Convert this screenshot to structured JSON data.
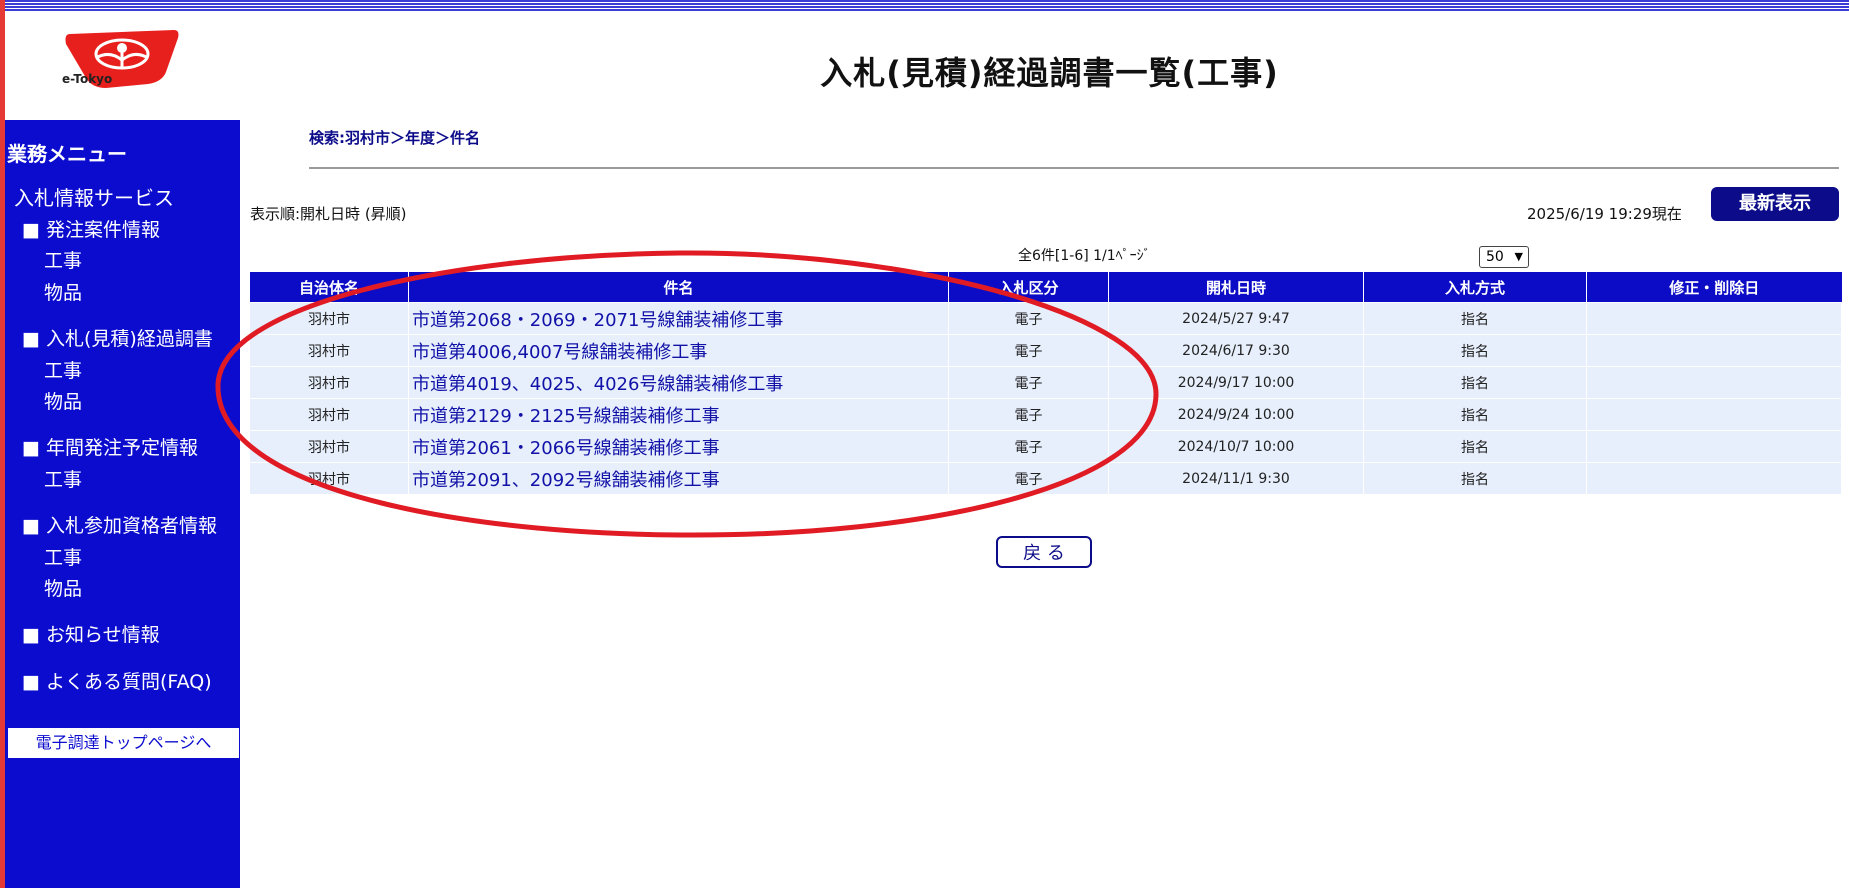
{
  "logo": {
    "text": "e-Tokyo"
  },
  "page_title": "入札(見積)経過調書一覧(工事)",
  "sidebar": {
    "title": "業務メニュー",
    "service": "入札情報サービス",
    "sections": [
      {
        "label": "■ 発注案件情報",
        "items": [
          "工事",
          "物品"
        ]
      },
      {
        "label": "■ 入札(見積)経過調書",
        "items": [
          "工事",
          "物品"
        ]
      },
      {
        "label": "■ 年間発注予定情報",
        "items": [
          "工事"
        ]
      },
      {
        "label": "■ 入札参加資格者情報",
        "items": [
          "工事",
          "物品"
        ]
      },
      {
        "label": "■ お知らせ情報",
        "items": []
      },
      {
        "label": "■ よくある質問(FAQ)",
        "items": []
      }
    ],
    "top_link": "電子調達トップページへ"
  },
  "breadcrumb": "検索:羽村市＞年度＞件名",
  "sort_label": "表示順:開札日時 (昇順)",
  "timestamp": "2025/6/19 19:29現在",
  "refresh_button": "最新表示",
  "count_text": "全6件[1-6] 1/1ﾍﾟｰｼﾞ",
  "per_page": "50",
  "table": {
    "headers": [
      "自治体名",
      "件名",
      "入札区分",
      "開札日時",
      "入札方式",
      "修正・削除日"
    ],
    "rows": [
      {
        "city": "羽村市",
        "name": "市道第2068・2069・2071号線舗装補修工事",
        "type": "電子",
        "date": "2024/5/27 9:47",
        "method": "指名",
        "modified": ""
      },
      {
        "city": "羽村市",
        "name": "市道第4006,4007号線舗装補修工事",
        "type": "電子",
        "date": "2024/6/17 9:30",
        "method": "指名",
        "modified": ""
      },
      {
        "city": "羽村市",
        "name": "市道第4019、4025、4026号線舗装補修工事",
        "type": "電子",
        "date": "2024/9/17 10:00",
        "method": "指名",
        "modified": ""
      },
      {
        "city": "羽村市",
        "name": "市道第2129・2125号線舗装補修工事",
        "type": "電子",
        "date": "2024/9/24 10:00",
        "method": "指名",
        "modified": ""
      },
      {
        "city": "羽村市",
        "name": "市道第2061・2066号線舗装補修工事",
        "type": "電子",
        "date": "2024/10/7 10:00",
        "method": "指名",
        "modified": ""
      },
      {
        "city": "羽村市",
        "name": "市道第2091、2092号線舗装補修工事",
        "type": "電子",
        "date": "2024/11/1 9:30",
        "method": "指名",
        "modified": ""
      }
    ]
  },
  "back_button": "戻 る",
  "colors": {
    "nav_blue": "#0c0ccf",
    "header_blue": "#0c0cc6",
    "row_bg": "#e6effb",
    "annotation_red": "#e01b24",
    "logo_red": "#e8201d"
  }
}
